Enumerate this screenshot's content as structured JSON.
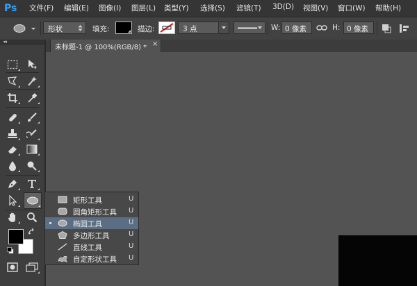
{
  "app": {
    "logo": "Ps"
  },
  "menu": [
    {
      "label": "文件(F)"
    },
    {
      "label": "编辑(E)"
    },
    {
      "label": "图像(I)"
    },
    {
      "label": "图层(L)"
    },
    {
      "label": "类型(Y)"
    },
    {
      "label": "选择(S)"
    },
    {
      "label": "滤镜(T)"
    },
    {
      "label": "3D(D)"
    },
    {
      "label": "视图(V)"
    },
    {
      "label": "窗口(W)"
    },
    {
      "label": "帮助(H)"
    }
  ],
  "options": {
    "mode_value": "形状",
    "fill_label": "填充:",
    "stroke_label": "描边:",
    "stroke_width": "3 点",
    "w_label": "W:",
    "w_value": "0 像素",
    "h_label": "H:",
    "h_value": "0 像素"
  },
  "tab": {
    "title": "未标题-1 @ 100%(RGB/8) *",
    "close": "×"
  },
  "flyout": [
    {
      "label": "矩形工具",
      "key": "U"
    },
    {
      "label": "圆角矩形工具",
      "key": "U"
    },
    {
      "label": "椭圆工具",
      "key": "U",
      "active": true
    },
    {
      "label": "多边形工具",
      "key": "U"
    },
    {
      "label": "直线工具",
      "key": "U"
    },
    {
      "label": "自定形状工具",
      "key": "U"
    }
  ],
  "colors": {
    "foreground": "#000000",
    "background": "#ffffff",
    "accent": "#2fa3f7",
    "flyout_active": "#5b6e83"
  }
}
